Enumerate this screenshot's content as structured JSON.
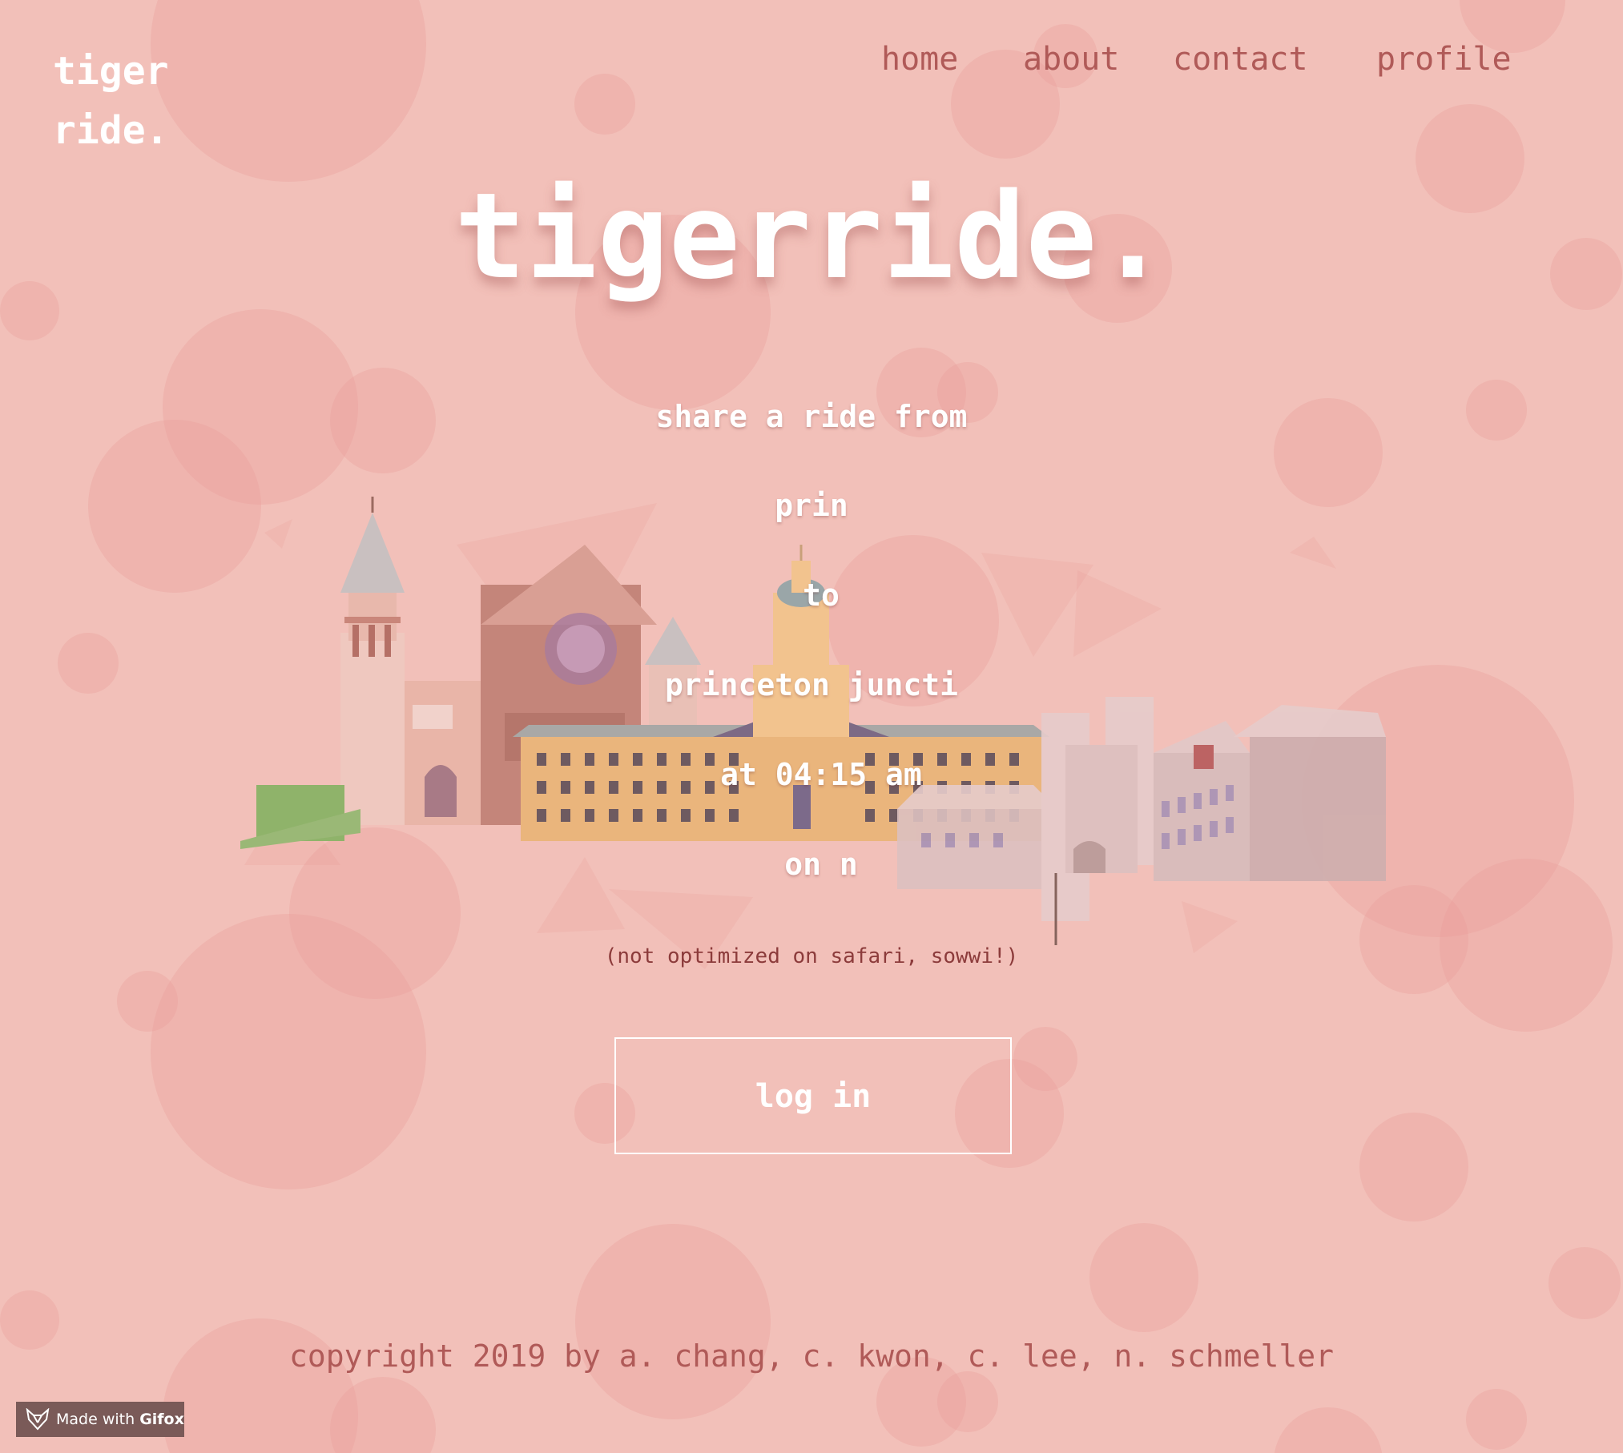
{
  "logo": {
    "line1": "tiger",
    "line2": "ride."
  },
  "nav": {
    "home": "home",
    "about": "about",
    "contact": "contact",
    "profile": "profile"
  },
  "hero": {
    "title": "tigerride."
  },
  "ride": {
    "line1": "share a ride from",
    "origin": "prin",
    "to": "to",
    "destination": "princeton juncti",
    "time": "at 04:15 am",
    "date": "on n"
  },
  "note": "(not optimized on safari, sowwi!)",
  "login": {
    "label": "log in"
  },
  "footer": "copyright 2019 by a. chang, c. kwon, c. lee, n. schmeller",
  "badge": {
    "made_with": "Made with",
    "brand": "Gifox"
  },
  "colors": {
    "background": "#f2c0b9",
    "bubble": "#ea9a98",
    "nav_text": "#b05a58",
    "white": "#ffffff",
    "note_text": "#8c3b3b"
  }
}
